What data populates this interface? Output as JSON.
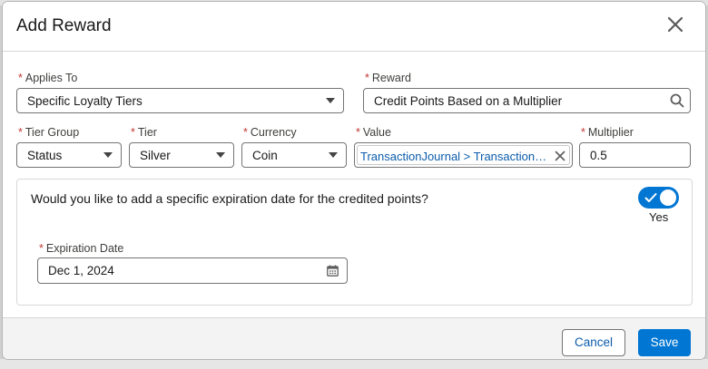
{
  "modal": {
    "title": "Add Reward"
  },
  "fields": {
    "applies_to": {
      "label": "Applies To",
      "value": "Specific Loyalty Tiers"
    },
    "reward": {
      "label": "Reward",
      "value": "Credit Points Based on a Multiplier"
    },
    "tier_group": {
      "label": "Tier Group",
      "value": "Status"
    },
    "tier": {
      "label": "Tier",
      "value": "Silver"
    },
    "currency": {
      "label": "Currency",
      "value": "Coin"
    },
    "value": {
      "label": "Value",
      "value": "TransactionJournal > TransactionAmount"
    },
    "multiplier": {
      "label": "Multiplier",
      "value": "0.5"
    },
    "required_marker": "*"
  },
  "expiration": {
    "question": "Would you like to add a specific expiration date for the credited points?",
    "toggle_label": "Yes",
    "toggle_on": true,
    "date_label": "Expiration Date",
    "date_value": "Dec 1, 2024"
  },
  "footer": {
    "cancel_label": "Cancel",
    "save_label": "Save"
  },
  "colors": {
    "brand": "#0176d3",
    "link": "#0b5cab",
    "required": "#c23934"
  },
  "icons": {
    "close": "close-icon",
    "search": "search-icon",
    "clear": "clear-icon",
    "calendar": "calendar-icon",
    "check": "check-icon",
    "caret": "chevron-down-icon"
  }
}
